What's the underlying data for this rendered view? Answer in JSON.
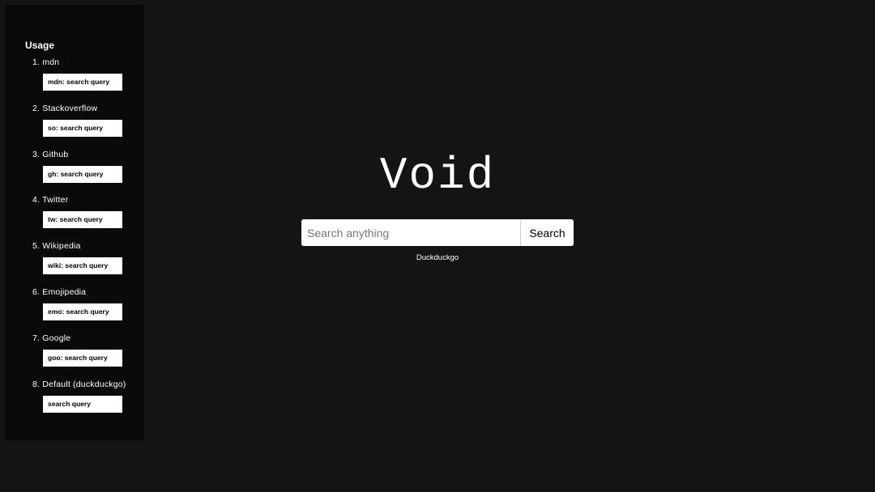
{
  "help": {
    "label": "?"
  },
  "sidebar": {
    "title": "Usage",
    "items": [
      {
        "label": "1. mdn",
        "example": "mdn: search query"
      },
      {
        "label": "2. Stackoverflow",
        "example": "so: search query"
      },
      {
        "label": "3. Github",
        "example": "gh: search query"
      },
      {
        "label": "4. Twitter",
        "example": "tw: search query"
      },
      {
        "label": "5. Wikipedia",
        "example": "wiki: search query"
      },
      {
        "label": "6. Emojipedia",
        "example": "emo: search query"
      },
      {
        "label": "7. Google",
        "example": "goo: search query"
      },
      {
        "label": "8. Default (duckduckgo)",
        "example": "search query"
      }
    ]
  },
  "main": {
    "logo": "Void",
    "search": {
      "placeholder": "Search anything",
      "value": "",
      "button_label": "Search"
    },
    "engine": "Duckduckgo"
  },
  "colors": {
    "background": "#141414",
    "sidebar": "#0a0a0a",
    "text": "#ffffff",
    "input": "#ffffff"
  }
}
